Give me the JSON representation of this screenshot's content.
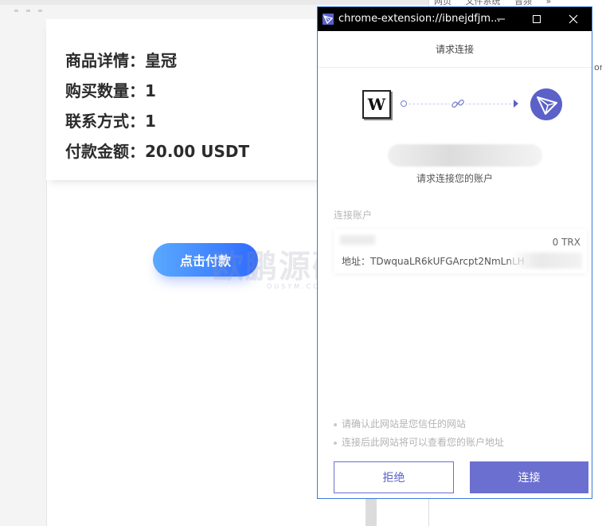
{
  "background_nav": {
    "items": [
      "网页",
      "文件系统",
      "音频",
      "»"
    ],
    "side_text": "or"
  },
  "order_details": {
    "product": "商品详情：皇冠",
    "quantity": "购买数量：1",
    "contact": "联系方式：1",
    "amount": "付款金额：20.00 USDT"
  },
  "pay_button_label": "点击付款",
  "watermark": {
    "text": "欧鹏源码",
    "sub": "OUSYM.COM"
  },
  "popup": {
    "window_title": "chrome-extension://ibnejdfjm...",
    "header": "请求连接",
    "connection": {
      "dapp_icon_letter": "W",
      "wallet_icon": "tronlink-icon",
      "link_icon": "link-icon"
    },
    "request_text": "请求连接您的账户",
    "section_label": "连接账户",
    "account": {
      "balance": "0 TRX",
      "address": "地址：TDwquaLR6kUFGArcpt2NmLnLH"
    },
    "notes": [
      "请确认此网站是您信任的网站",
      "连接后此网站将可以查看您的账户地址"
    ],
    "reject_label": "拒绝",
    "connect_label": "连接"
  },
  "colors": {
    "accent": "#6b6fcf",
    "pay_gradient_start": "#5aa9ff",
    "pay_gradient_end": "#2f6bff",
    "titlebar": "#000000"
  }
}
